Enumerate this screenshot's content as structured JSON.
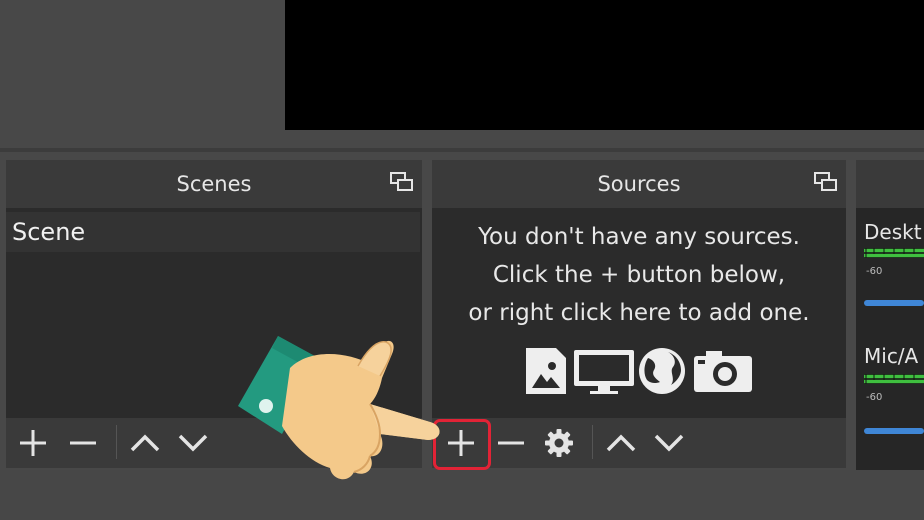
{
  "scenes": {
    "title": "Scenes",
    "items": [
      "Scene"
    ]
  },
  "sources": {
    "title": "Sources",
    "empty_hint": [
      "You don't have any sources.",
      "Click the + button below,",
      "or right click here to add one."
    ]
  },
  "mixer": {
    "channels": [
      {
        "label": "Deskt",
        "db_mark": "-60"
      },
      {
        "label": "Mic/A",
        "db_mark": "-60"
      }
    ]
  },
  "icons": {
    "add": "plus-icon",
    "remove": "minus-icon",
    "up": "chevron-up-icon",
    "down": "chevron-down-icon",
    "settings": "gear-icon",
    "dock": "undock-icon",
    "pointer": "pointing-hand-icon"
  },
  "colors": {
    "highlight": "#e22336",
    "panel_bg": "#2b2b2b",
    "header_bg": "#3a3a3a",
    "slider": "#3f86d6",
    "meter": "#3fbf3f"
  }
}
